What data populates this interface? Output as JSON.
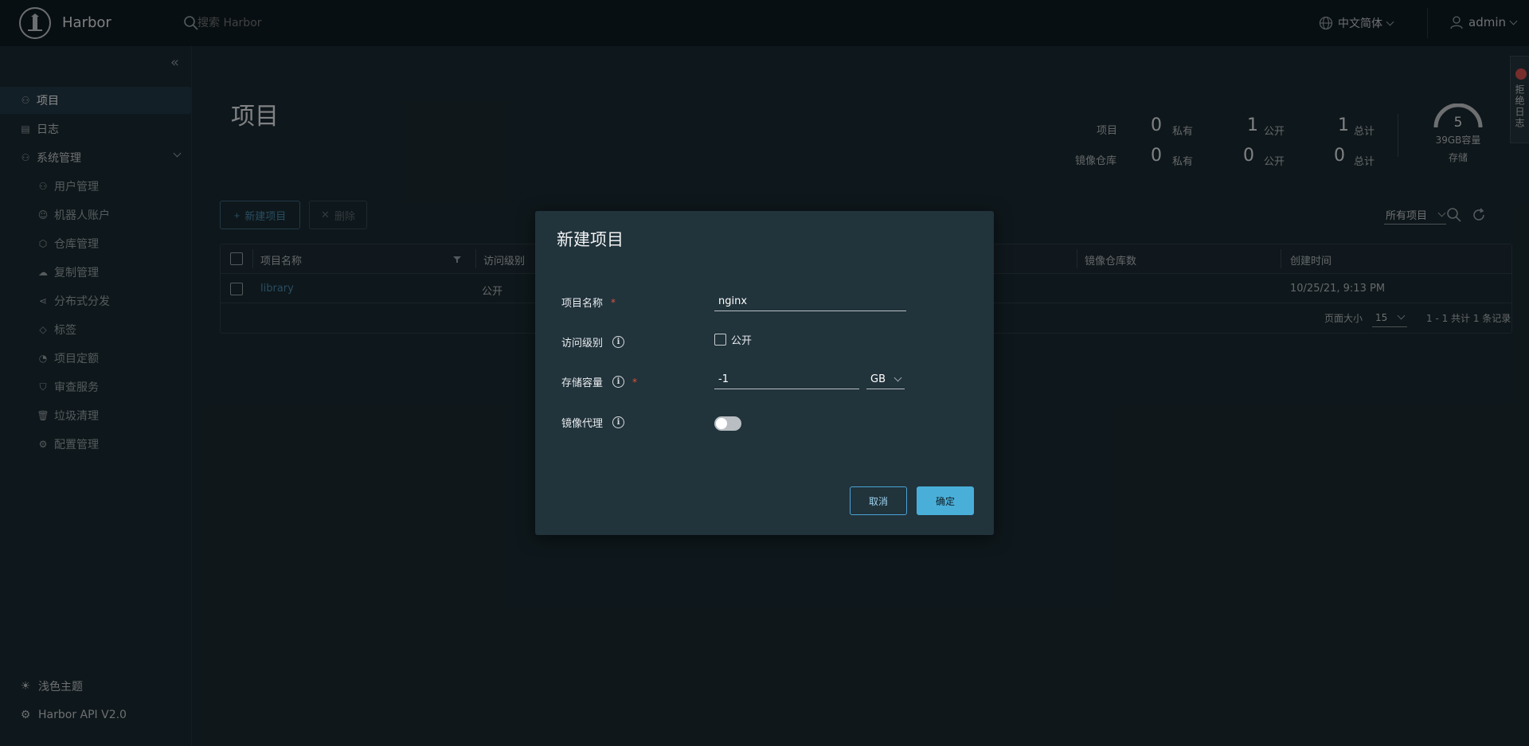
{
  "header": {
    "app_name": "Harbor",
    "search_placeholder": "搜索 Harbor",
    "language": "中文简体",
    "user": "admin"
  },
  "sidebar": {
    "items": [
      {
        "label": "项目",
        "icon": "projects-icon",
        "active": true
      },
      {
        "label": "日志",
        "icon": "logs-icon"
      },
      {
        "label": "系统管理",
        "icon": "admin-icon"
      }
    ],
    "sub_items": [
      {
        "label": "用户管理",
        "icon": "users-icon"
      },
      {
        "label": "机器人账户",
        "icon": "robot-icon"
      },
      {
        "label": "仓库管理",
        "icon": "registry-icon"
      },
      {
        "label": "复制管理",
        "icon": "replication-icon"
      },
      {
        "label": "分布式分发",
        "icon": "share-icon"
      },
      {
        "label": "标签",
        "icon": "tag-icon"
      },
      {
        "label": "项目定额",
        "icon": "quota-icon"
      },
      {
        "label": "审查服务",
        "icon": "shield-icon"
      },
      {
        "label": "垃圾清理",
        "icon": "trash-icon"
      },
      {
        "label": "配置管理",
        "icon": "gear-icon"
      }
    ],
    "bottom": {
      "theme": "浅色主题",
      "api": "Harbor API V2.0"
    }
  },
  "main": {
    "title": "项目",
    "stats": {
      "projects_label": "项目",
      "repos_label": "镜像仓库",
      "private_label": "私有",
      "public_label": "公开",
      "total_label": "总计",
      "projects_private": "0",
      "projects_public": "1",
      "projects_total": "1",
      "repos_private": "0",
      "repos_public": "0",
      "repos_total": "0"
    },
    "storage": {
      "value": "5",
      "capacity": "39GB容量",
      "label": "存储"
    },
    "side_tab": "拒绝日志",
    "actions": {
      "new_project": "新建项目",
      "delete": "删除"
    },
    "filter": "所有项目",
    "table": {
      "headers": [
        "项目名称",
        "访问级别",
        "镜像仓库数",
        "创建时间"
      ],
      "rows": [
        {
          "name": "library",
          "access": "公开",
          "created": "10/25/21, 9:13 PM"
        }
      ],
      "page_size_label": "页面大小",
      "page_size": "15",
      "summary": "1 - 1 共计 1 条记录"
    }
  },
  "modal": {
    "title": "新建项目",
    "name_label": "项目名称",
    "name_value": "nginx",
    "access_label": "访问级别",
    "public_label": "公开",
    "quota_label": "存储容量",
    "quota_value": "-1",
    "quota_unit": "GB",
    "proxy_label": "镜像代理",
    "proxy_on": false,
    "cancel": "取消",
    "ok": "确定"
  },
  "colors": {
    "primary": "#49afd9",
    "link": "#4a8db1",
    "header_bg": "#0f1d24",
    "body_bg": "#1b2a32",
    "required": "#e0533b"
  }
}
